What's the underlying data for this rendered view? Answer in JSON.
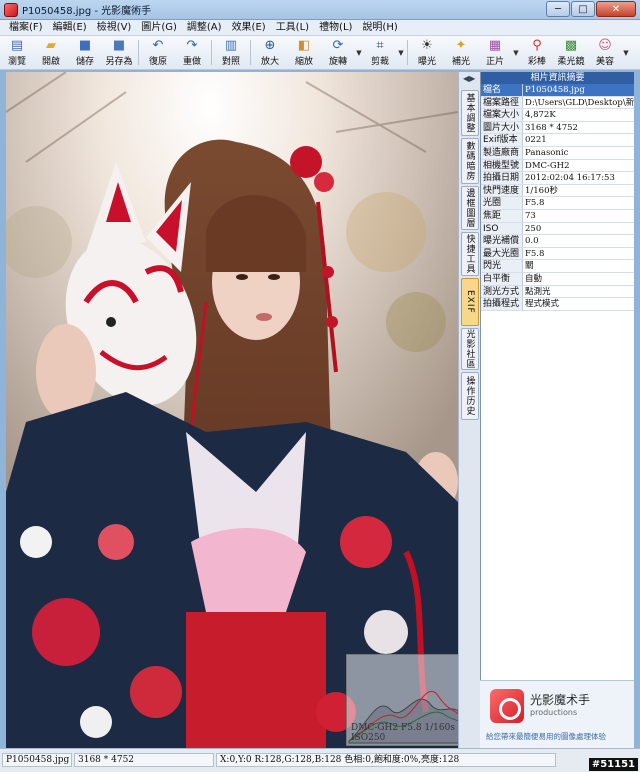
{
  "window": {
    "title": "P1050458.jpg - 光影魔術手",
    "controls": [
      "─",
      "□",
      "✕"
    ]
  },
  "menu": [
    "檔案(F)",
    "編輯(E)",
    "檢視(V)",
    "圖片(G)",
    "調整(A)",
    "效果(E)",
    "工具(L)",
    "禮物(L)",
    "說明(H)"
  ],
  "toolbar": [
    {
      "label": "瀏覽",
      "icon": "browse-icon",
      "glyph": "▤",
      "color": "#3b6fb5"
    },
    {
      "label": "開啟",
      "icon": "open-folder-icon",
      "glyph": "▰",
      "color": "#e2a933"
    },
    {
      "label": "儲存",
      "icon": "save-icon",
      "glyph": "■",
      "color": "#3f6fb9"
    },
    {
      "label": "另存為",
      "icon": "save-as-icon",
      "glyph": "■",
      "color": "#4c7ab8"
    },
    {
      "label": "復原",
      "icon": "undo-icon",
      "glyph": "↶",
      "color": "#2c62b2"
    },
    {
      "label": "重做",
      "icon": "redo-icon",
      "glyph": "↷",
      "color": "#2c62b2"
    },
    {
      "label": "對照",
      "icon": "compare-icon",
      "glyph": "▥",
      "color": "#3e6fb4"
    },
    {
      "label": "放大",
      "icon": "zoom-in-icon",
      "glyph": "⊕",
      "color": "#2b5aa0"
    },
    {
      "label": "縮放",
      "icon": "resize-icon",
      "glyph": "◧",
      "color": "#d08f2a"
    },
    {
      "label": "旋轉",
      "icon": "rotate-icon",
      "glyph": "⟳",
      "color": "#2f66b0",
      "dropdown": true
    },
    {
      "label": "剪裁",
      "icon": "crop-icon",
      "glyph": "⌗",
      "color": "#2b4f86",
      "dropdown": true
    },
    {
      "label": "曝光",
      "icon": "exposure-icon",
      "glyph": "☀",
      "color": "#333333"
    },
    {
      "label": "補光",
      "icon": "fill-light-icon",
      "glyph": "✦",
      "color": "#e0a020"
    },
    {
      "label": "正片",
      "icon": "positive-film-icon",
      "glyph": "▦",
      "color": "#a04aa8",
      "dropdown": true
    },
    {
      "label": "彩棒",
      "icon": "color-wand-icon",
      "glyph": "⚲",
      "color": "#c4362e"
    },
    {
      "label": "柔光鏡",
      "icon": "soft-light-icon",
      "glyph": "▩",
      "color": "#3a8a3a"
    },
    {
      "label": "美容",
      "icon": "beauty-icon",
      "glyph": "☺",
      "color": "#cc5a7a",
      "dropdown": true
    }
  ],
  "vtabs": [
    {
      "label": "基本調整",
      "active": false
    },
    {
      "label": "數碼暗房",
      "active": false
    },
    {
      "label": "邊框圖層",
      "active": false
    },
    {
      "label": "快捷工具",
      "active": false
    },
    {
      "label": "EXIF",
      "active": true
    },
    {
      "label": "光影社區",
      "active": false
    },
    {
      "label": "操作历史",
      "active": false
    }
  ],
  "panel": {
    "title": "相片資訊摘要",
    "rows": [
      {
        "key": "檔名",
        "value": "P1050458.jpg"
      },
      {
        "key": "檔案路徑",
        "value": "D:\\Users\\GLD\\Desktop\\新增資"
      },
      {
        "key": "檔案大小",
        "value": "4,872K"
      },
      {
        "key": "圖片大小",
        "value": "3168 * 4752"
      },
      {
        "key": "Exif版本",
        "value": "0221"
      },
      {
        "key": "製造廠商",
        "value": "Panasonic"
      },
      {
        "key": "相機型號",
        "value": "DMC-GH2"
      },
      {
        "key": "拍攝日期",
        "value": "2012:02:04 16:17:53"
      },
      {
        "key": "快門速度",
        "value": "1/160秒"
      },
      {
        "key": "光圈",
        "value": "F5.8"
      },
      {
        "key": "焦距",
        "value": "73"
      },
      {
        "key": "ISO",
        "value": "250"
      },
      {
        "key": "曝光補償",
        "value": "0.0"
      },
      {
        "key": "最大光圈",
        "value": "F5.8"
      },
      {
        "key": "閃光",
        "value": "關"
      },
      {
        "key": "白平衡",
        "value": "自動"
      },
      {
        "key": "測光方式",
        "value": "點測光"
      },
      {
        "key": "拍攝程式",
        "value": "程式模式"
      }
    ]
  },
  "histogram": {
    "caption_line1": "DMC-GH2 F5.8 1/160s",
    "caption_line2": "ISO250"
  },
  "ad": {
    "name": "光影魔术手",
    "sub": "productions",
    "tagline": "給您帶來最簡便易用的圖像處理体验"
  },
  "status": {
    "filename": "P1050458.jpg",
    "size": "3168 * 4752",
    "pixel_info": "X:0,Y:0 R:128,G:128,B:128 色相:0,飽和度:0%,亮度:128"
  },
  "watermark": "#51151"
}
